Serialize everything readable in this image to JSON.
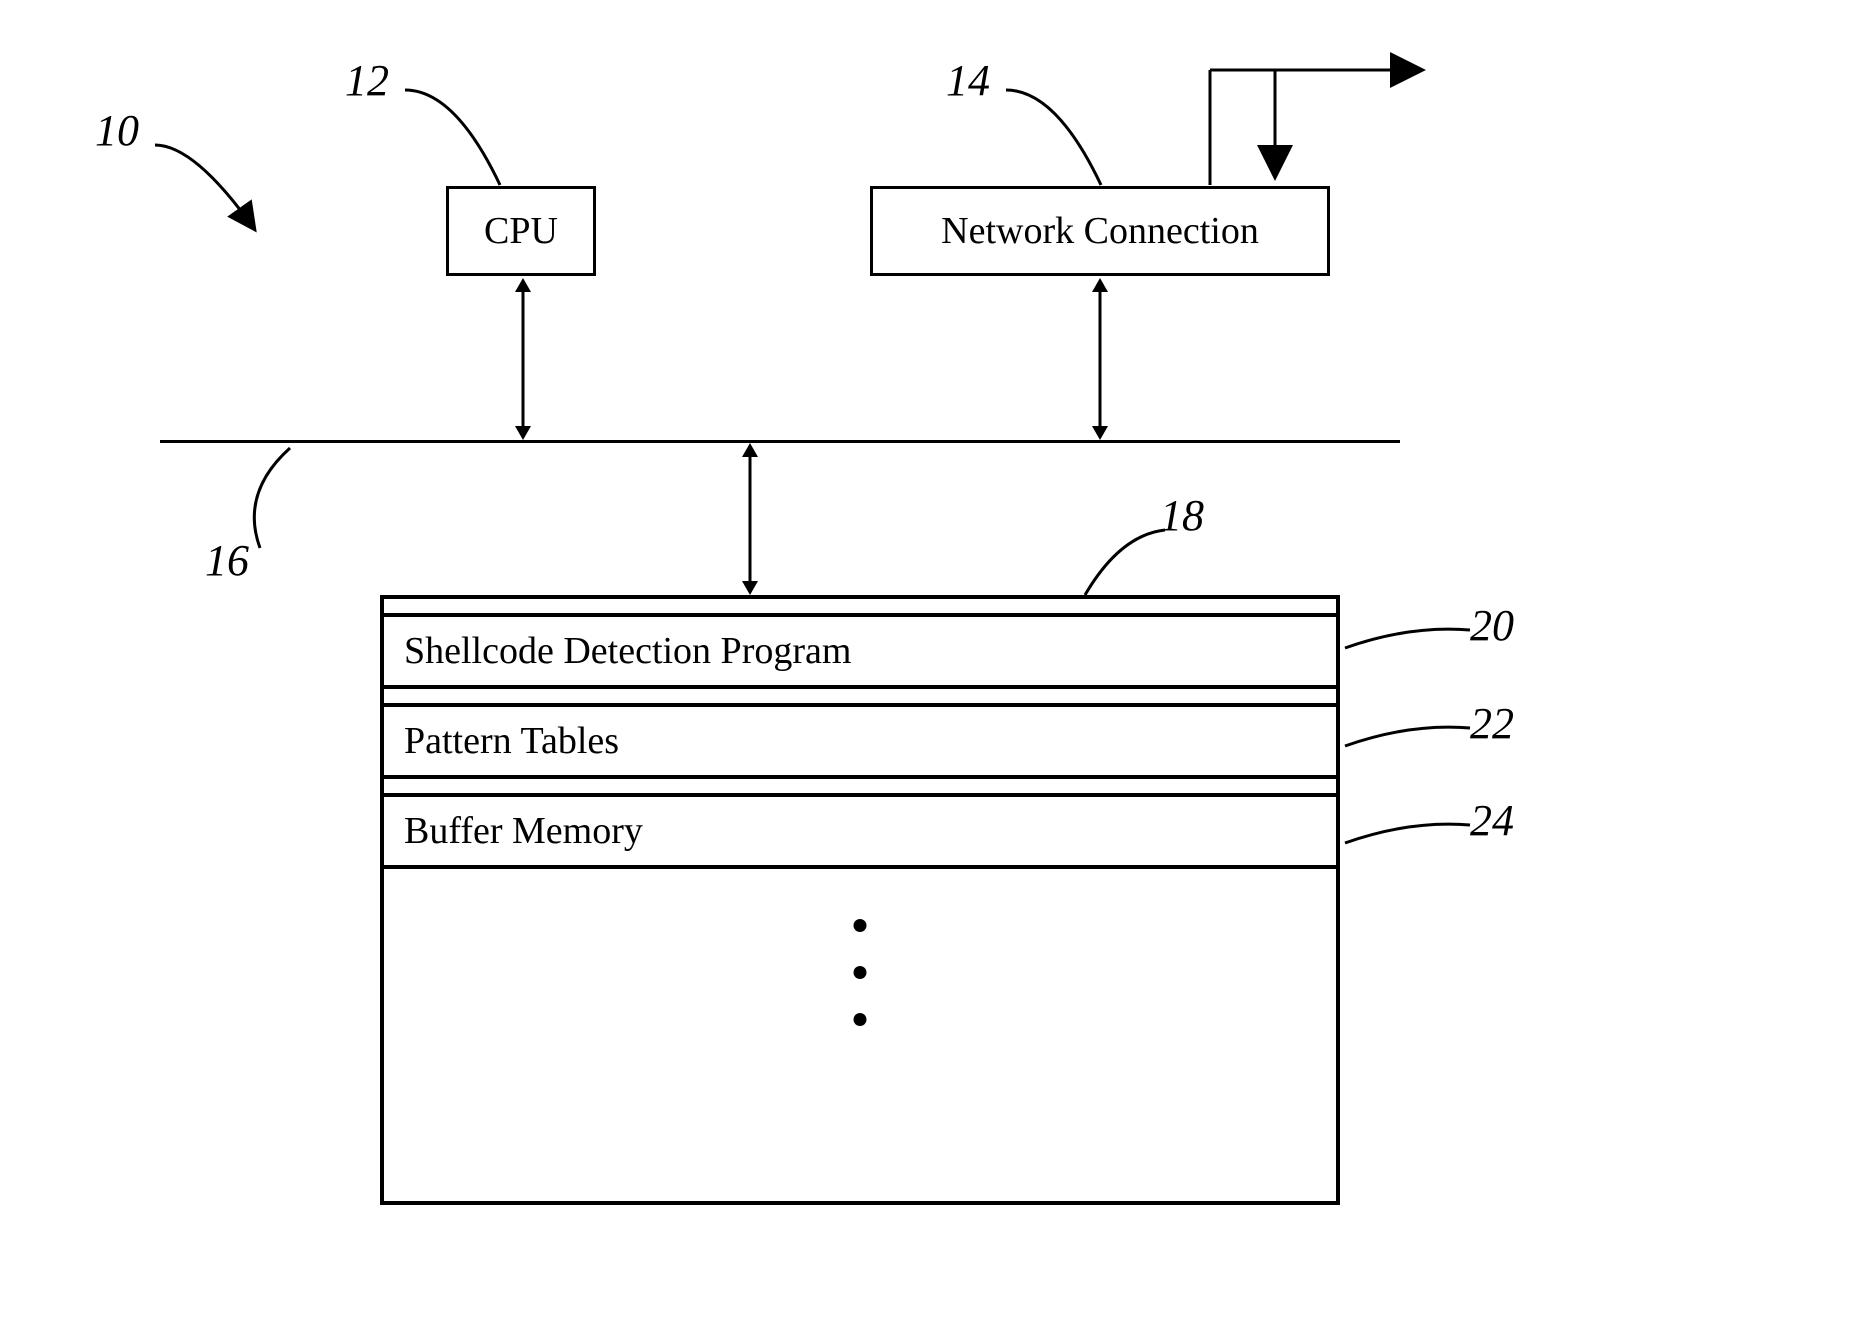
{
  "labels": {
    "ref_10": "10",
    "ref_12": "12",
    "ref_14": "14",
    "ref_16": "16",
    "ref_18": "18",
    "ref_20": "20",
    "ref_22": "22",
    "ref_24": "24"
  },
  "blocks": {
    "cpu": "CPU",
    "network": "Network Connection",
    "shellcode": "Shellcode Detection Program",
    "pattern": "Pattern Tables",
    "buffer": "Buffer Memory"
  }
}
